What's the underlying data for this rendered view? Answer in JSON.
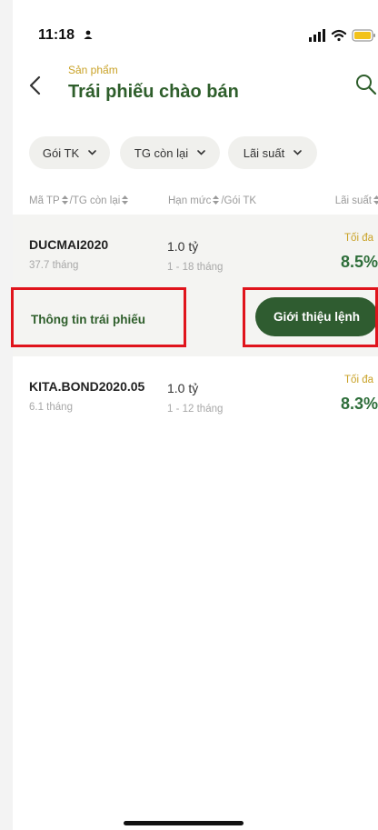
{
  "status_bar": {
    "time": "11:18"
  },
  "header": {
    "overline": "Sản phẩm",
    "title": "Trái phiếu chào bán"
  },
  "filters": [
    {
      "label": "Gói TK"
    },
    {
      "label": "TG còn lại"
    },
    {
      "label": "Lãi suất"
    }
  ],
  "columns": {
    "code_head": "Mã TP",
    "remaining_head": "/TG còn lại",
    "limit_head": "Hạn mức",
    "package_head": "/Gói TK",
    "rate_head": "Lãi suất"
  },
  "bonds": [
    {
      "code": "DUCMAI2020",
      "remaining": "37.7 tháng",
      "limit": "1.0 tỷ",
      "range": "1 - 18 tháng",
      "rate_label": "Tối đa",
      "rate": "8.5%",
      "info_link": "Thông tin trái phiếu",
      "intro_button": "Giới thiệu lệnh"
    },
    {
      "code": "KITA.BOND2020.05",
      "remaining": "6.1 tháng",
      "limit": "1.0 tỷ",
      "range": "1 - 12 tháng",
      "rate_label": "Tối đa",
      "rate": "8.3%"
    }
  ],
  "colors": {
    "primary_green": "#2e5e2b",
    "gold": "#c9a227",
    "rate_green": "#2e6e3a",
    "highlight_red": "#e0141c"
  },
  "icons": [
    "person-icon",
    "signal-icon",
    "wifi-icon",
    "battery-icon",
    "back-icon",
    "search-icon",
    "chevron-down-icon",
    "sort-icon"
  ]
}
